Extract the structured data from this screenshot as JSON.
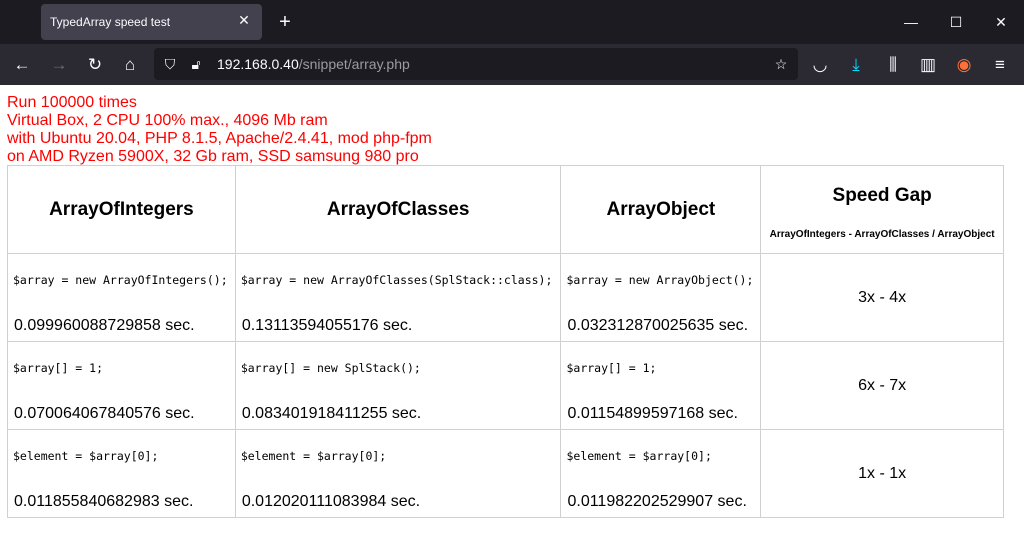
{
  "browser": {
    "tab_title": "TypedArray speed test",
    "url_host": "192.168.0.40",
    "url_path": "/snippet/array.php"
  },
  "info": {
    "line1": "Run 100000 times",
    "line2": "Virtual Box, 2 CPU 100% max., 4096 Mb ram",
    "line3": "with Ubuntu 20.04, PHP 8.1.5, Apache/2.4.41, mod php-fpm",
    "line4": "on AMD Ryzen 5900X, 32 Gb ram, SSD samsung 980 pro"
  },
  "table": {
    "headers": [
      "ArrayOfIntegers",
      "ArrayOfClasses",
      "ArrayObject"
    ],
    "gap_header": "Speed Gap",
    "gap_subheader": "ArrayOfIntegers - ArrayOfClasses / ArrayObject",
    "rows": [
      {
        "cells": [
          {
            "code": "$array = new ArrayOfIntegers();",
            "time": "0.099960088729858 sec."
          },
          {
            "code": "$array = new ArrayOfClasses(SplStack::class);",
            "time": "0.13113594055176 sec."
          },
          {
            "code": "$array = new ArrayObject();",
            "time": "0.032312870025635 sec."
          }
        ],
        "gap": "3x - 4x"
      },
      {
        "cells": [
          {
            "code": "$array[] = 1;",
            "time": "0.070064067840576 sec."
          },
          {
            "code": "$array[] = new SplStack();",
            "time": "0.083401918411255 sec."
          },
          {
            "code": "$array[] = 1;",
            "time": "0.01154899597168 sec."
          }
        ],
        "gap": "6x - 7x"
      },
      {
        "cells": [
          {
            "code": "$element = $array[0];",
            "time": "0.011855840682983 sec."
          },
          {
            "code": "$element = $array[0];",
            "time": "0.012020111083984 sec."
          },
          {
            "code": "$element = $array[0];",
            "time": "0.011982202529907 sec."
          }
        ],
        "gap": "1x - 1x"
      }
    ]
  }
}
